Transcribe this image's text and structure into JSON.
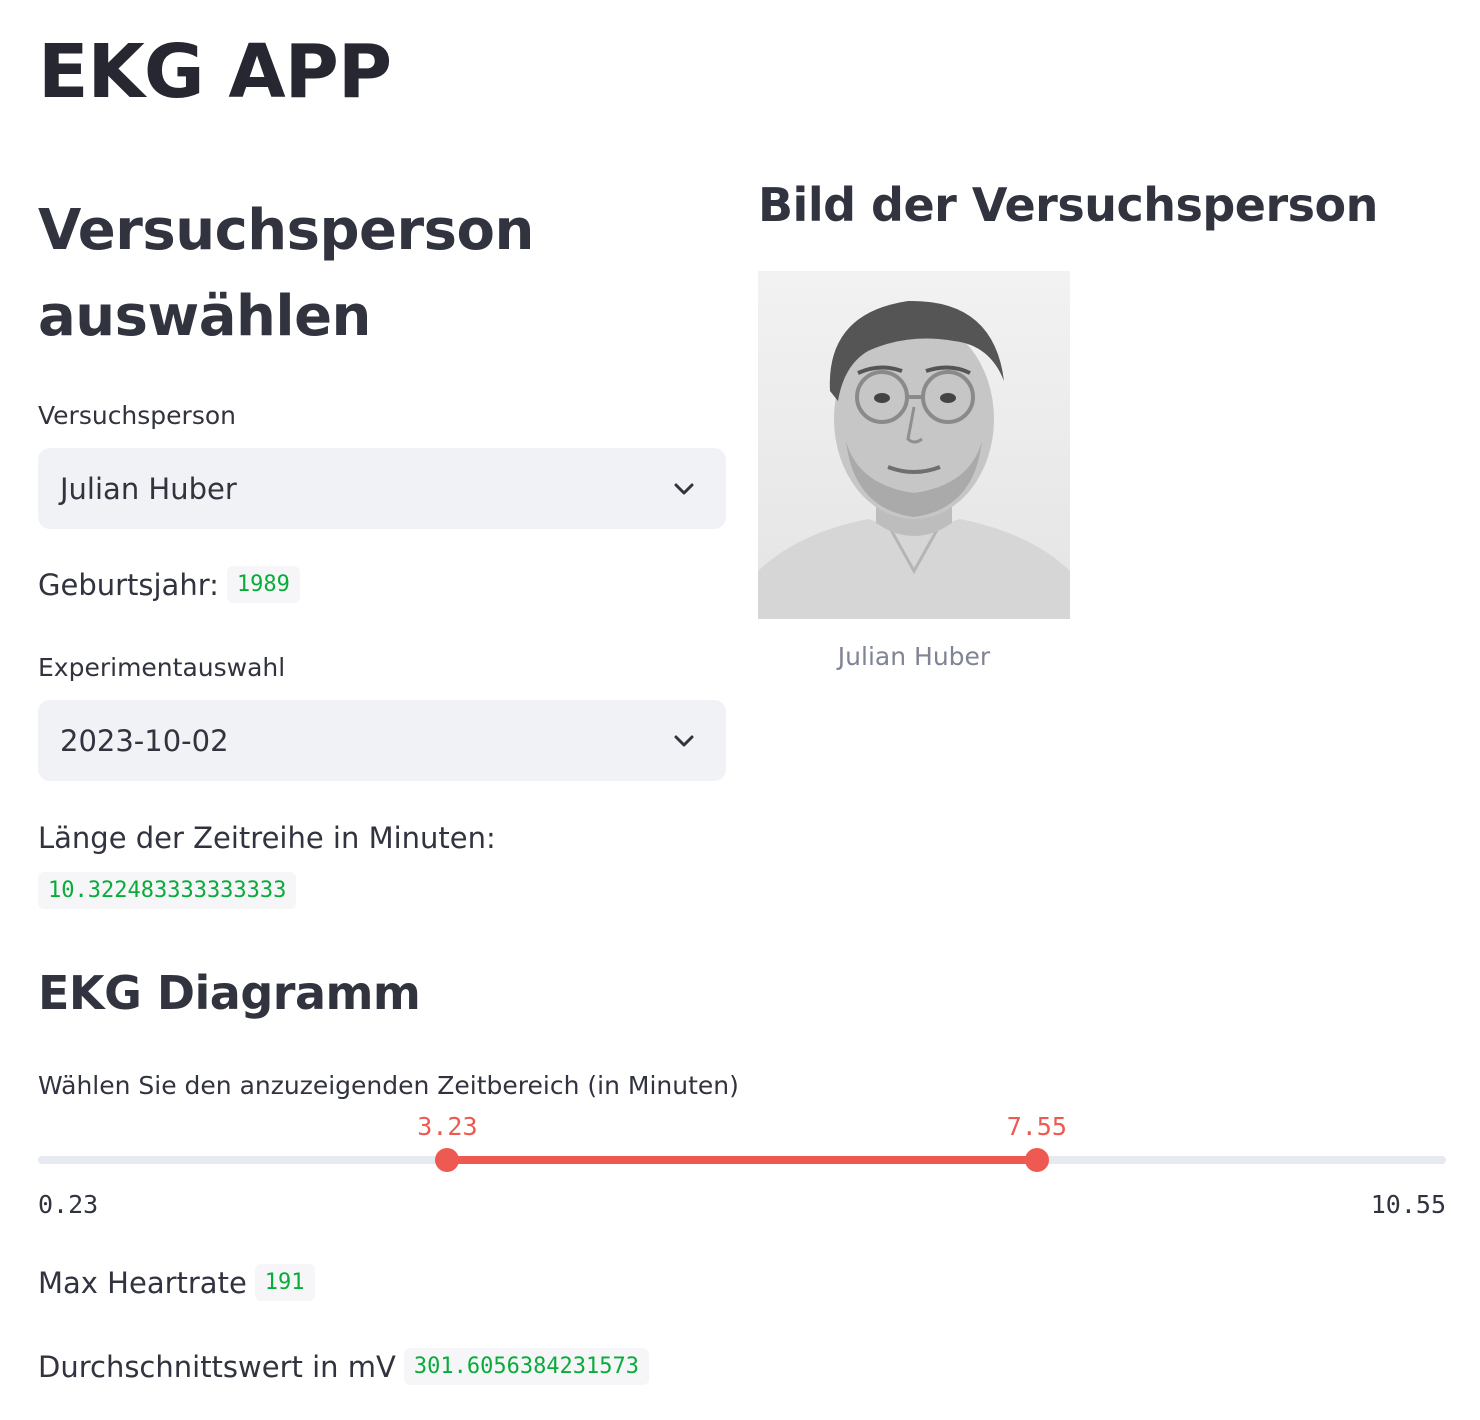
{
  "app": {
    "title": "EKG APP"
  },
  "left": {
    "heading": "Versuchsperson auswählen",
    "person_select": {
      "label": "Versuchsperson",
      "value": "Julian Huber"
    },
    "birth_year": {
      "label": "Geburtsjahr:",
      "value": "1989"
    },
    "experiment_select": {
      "label": "Experimentauswahl",
      "value": "2023-10-02"
    },
    "series_length": {
      "label": "Länge der Zeitreihe in Minuten:",
      "value": "10.322483333333333"
    }
  },
  "right": {
    "heading": "Bild der Versuchsperson",
    "photo_caption": "Julian Huber"
  },
  "ekg": {
    "heading": "EKG Diagramm",
    "range_slider": {
      "label": "Wählen Sie den anzuzeigenden Zeitbereich (in Minuten)",
      "min": 0.23,
      "max": 10.55,
      "min_label": "0.23",
      "max_label": "10.55",
      "low": 3.23,
      "high": 7.55,
      "low_label": "3.23",
      "high_label": "7.55"
    },
    "max_heartrate": {
      "label": "Max Heartrate",
      "value": "191"
    },
    "mean_mv": {
      "label": "Durchschnittswert in mV",
      "value": "301.6056384231573"
    }
  },
  "colors": {
    "accent": "#ee5a52",
    "code_text": "#09ab3b",
    "input_bg": "#f0f2f6"
  },
  "icons": {
    "select_arrow": "chevron-down-icon"
  }
}
